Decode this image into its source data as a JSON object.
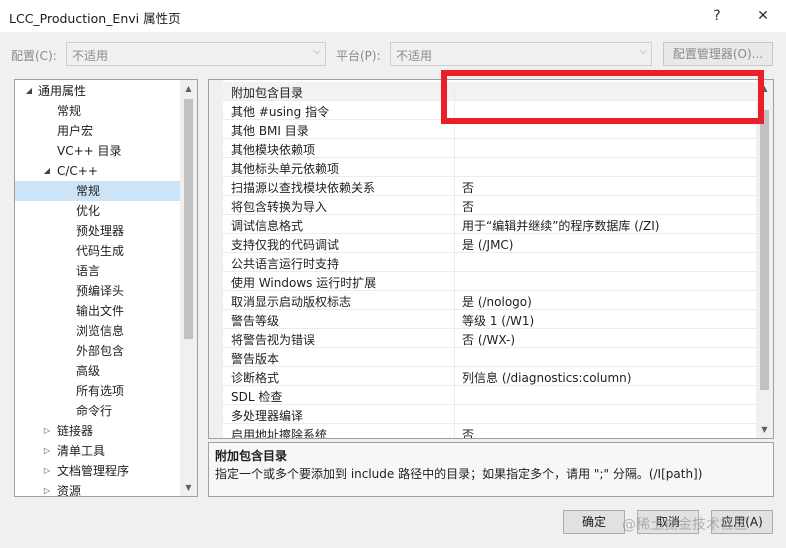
{
  "window": {
    "title": "LCC_Production_Envi 属性页",
    "help": "?",
    "close": "✕"
  },
  "config": {
    "config_label": "配置(C):",
    "config_value": "不适用",
    "platform_label": "平台(P):",
    "platform_value": "不适用",
    "manager_button": "配置管理器(O)..."
  },
  "tree": {
    "items": [
      {
        "label": "通用属性",
        "expander": "◢"
      },
      {
        "label": "常规"
      },
      {
        "label": "用户宏"
      },
      {
        "label": "VC++ 目录"
      },
      {
        "label": "C/C++",
        "expander": "◢"
      },
      {
        "label": "常规"
      },
      {
        "label": "优化"
      },
      {
        "label": "预处理器"
      },
      {
        "label": "代码生成"
      },
      {
        "label": "语言"
      },
      {
        "label": "预编译头"
      },
      {
        "label": "输出文件"
      },
      {
        "label": "浏览信息"
      },
      {
        "label": "外部包含"
      },
      {
        "label": "高级"
      },
      {
        "label": "所有选项"
      },
      {
        "label": "命令行"
      },
      {
        "label": "链接器",
        "expander": "▷"
      },
      {
        "label": "清单工具",
        "expander": "▷"
      },
      {
        "label": "文档管理程序",
        "expander": "▷"
      },
      {
        "label": "资源",
        "expander": "▷"
      }
    ]
  },
  "properties": {
    "rows": [
      {
        "name": "附加包含目录",
        "value": ""
      },
      {
        "name": "其他 #using 指令",
        "value": ""
      },
      {
        "name": "其他 BMI 目录",
        "value": ""
      },
      {
        "name": "其他模块依赖项",
        "value": ""
      },
      {
        "name": "其他标头单元依赖项",
        "value": ""
      },
      {
        "name": "扫描源以查找模块依赖关系",
        "value": "否"
      },
      {
        "name": "将包含转换为导入",
        "value": "否"
      },
      {
        "name": "调试信息格式",
        "value": "用于“编辑并继续”的程序数据库 (/ZI)"
      },
      {
        "name": "支持仅我的代码调试",
        "value": "是 (/JMC)"
      },
      {
        "name": "公共语言运行时支持",
        "value": ""
      },
      {
        "name": "使用 Windows 运行时扩展",
        "value": ""
      },
      {
        "name": "取消显示启动版权标志",
        "value": "是 (/nologo)"
      },
      {
        "name": "警告等级",
        "value": "等级 1 (/W1)"
      },
      {
        "name": "将警告视为错误",
        "value": "否 (/WX-)"
      },
      {
        "name": "警告版本",
        "value": ""
      },
      {
        "name": "诊断格式",
        "value": "列信息 (/diagnostics:column)"
      },
      {
        "name": "SDL 检查",
        "value": ""
      },
      {
        "name": "多处理器编译",
        "value": ""
      },
      {
        "name": "启用地址擦除系统",
        "value": "否"
      }
    ]
  },
  "description": {
    "title": "附加包含目录",
    "text": "指定一个或多个要添加到 include 路径中的目录；如果指定多个，请用 \";\" 分隔。(/I[path])"
  },
  "buttons": {
    "ok": "确定",
    "cancel": "取消",
    "apply": "应用(A)"
  },
  "watermark": "@稀土掘金技术社区",
  "colors": {
    "highlight_box": "#e8202a",
    "tree_selection": "#cce4f7"
  }
}
